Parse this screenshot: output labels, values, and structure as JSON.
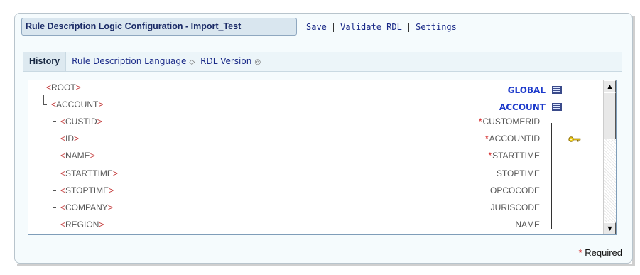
{
  "title_tab": "Rule Description Logic Configuration - Import_Test",
  "actions": {
    "save": "Save",
    "validate": "Validate RDL",
    "settings": "Settings",
    "separator": "|"
  },
  "tabs": {
    "history": "History",
    "rdl_language": "Rule Description Language",
    "rdl_language_icon": "◇",
    "rdl_version": "RDL Version",
    "rdl_version_icon": "◎"
  },
  "tree": {
    "lt": "<",
    "gt": ">",
    "root": "ROOT",
    "account": "ACCOUNT",
    "children": [
      "CUSTID",
      "ID",
      "NAME",
      "STARTTIME",
      "STOPTIME",
      "COMPANY",
      "REGION"
    ]
  },
  "right": {
    "global": "GLOBAL",
    "account": "ACCOUNT",
    "required_mark": "*",
    "fields": [
      "CUSTOMERID",
      "ACCOUNTID",
      "STARTTIME",
      "STOPTIME",
      "OPCOCODE",
      "JURISCODE",
      "NAME"
    ],
    "required_fields": [
      true,
      true,
      true,
      false,
      false,
      false,
      false
    ],
    "key_field": "ACCOUNTID"
  },
  "footer": {
    "mark": "*",
    "required_label": "Required"
  },
  "colors": {
    "accent": "#1d3acb",
    "tag": "#c03030",
    "required": "#d21e1e",
    "link": "#1a2a88"
  },
  "icons": {
    "table": "table-icon",
    "key": "key-icon",
    "scroll_up": "arrow-up-icon",
    "scroll_down": "arrow-down-icon"
  }
}
